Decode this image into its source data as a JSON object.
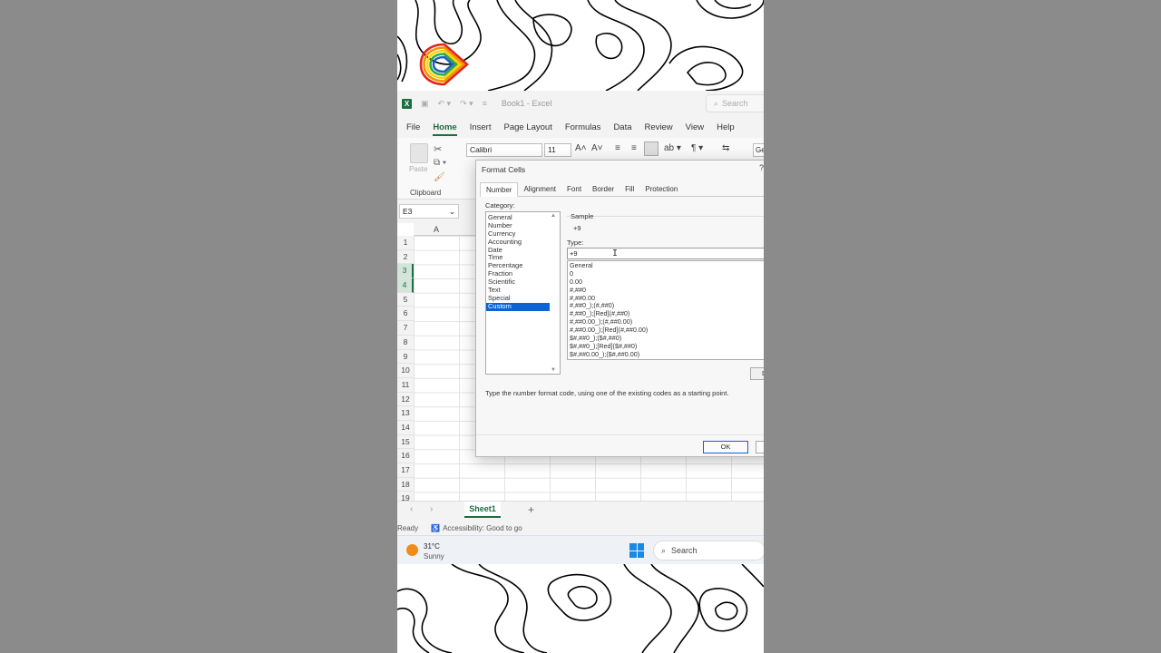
{
  "excel": {
    "title": "Book1 - Excel",
    "search_label": "Search",
    "menu": [
      "File",
      "Home",
      "Insert",
      "Page Layout",
      "Formulas",
      "Data",
      "Review",
      "View",
      "Help"
    ],
    "ribbon": {
      "paste_label": "Paste",
      "clipboard_label": "Clipboard",
      "font_name": "Calibri",
      "font_size": "11",
      "number_format_short": "Ge"
    },
    "namebox": "E3",
    "column_header": "A",
    "row_numbers": [
      "1",
      "2",
      "3",
      "4",
      "5",
      "6",
      "7",
      "8",
      "9",
      "10",
      "11",
      "12",
      "13",
      "14",
      "15",
      "16",
      "17",
      "18",
      "19"
    ],
    "sheet_tab": "Sheet1",
    "status_ready": "Ready",
    "status_accessibility": "Accessibility: Good to go"
  },
  "dialog": {
    "title": "Format Cells",
    "help": "?",
    "tabs": [
      "Number",
      "Alignment",
      "Font",
      "Border",
      "Fill",
      "Protection"
    ],
    "category_label": "Category:",
    "categories": [
      "General",
      "Number",
      "Currency",
      "Accounting",
      "Date",
      "Time",
      "Percentage",
      "Fraction",
      "Scientific",
      "Text",
      "Special",
      "Custom"
    ],
    "selected_category": "Custom",
    "sample_label": "Sample",
    "sample_value": "+9",
    "type_label": "Type:",
    "type_value": "+9",
    "formats": [
      "General",
      "0",
      "0.00",
      "#,##0",
      "#,##0.00",
      "#,##0_);(#,##0)",
      "#,##0_);[Red](#,##0)",
      "#,##0.00_);(#,##0.00)",
      "#,##0.00_);[Red](#,##0.00)",
      "$#,##0_);($#,##0)",
      "$#,##0_);[Red]($#,##0)",
      "$#,##0.00_);($#,##0.00)"
    ],
    "delete_label": "D",
    "hint": "Type the number format code, using one of the existing codes as a starting point.",
    "ok_label": "OK"
  },
  "taskbar": {
    "temperature": "31°C",
    "condition": "Sunny",
    "search_label": "Search"
  },
  "colors": {
    "excel_green": "#1d6f42",
    "selection_blue": "#0a64d8",
    "background_gray": "#8b8b8b"
  }
}
